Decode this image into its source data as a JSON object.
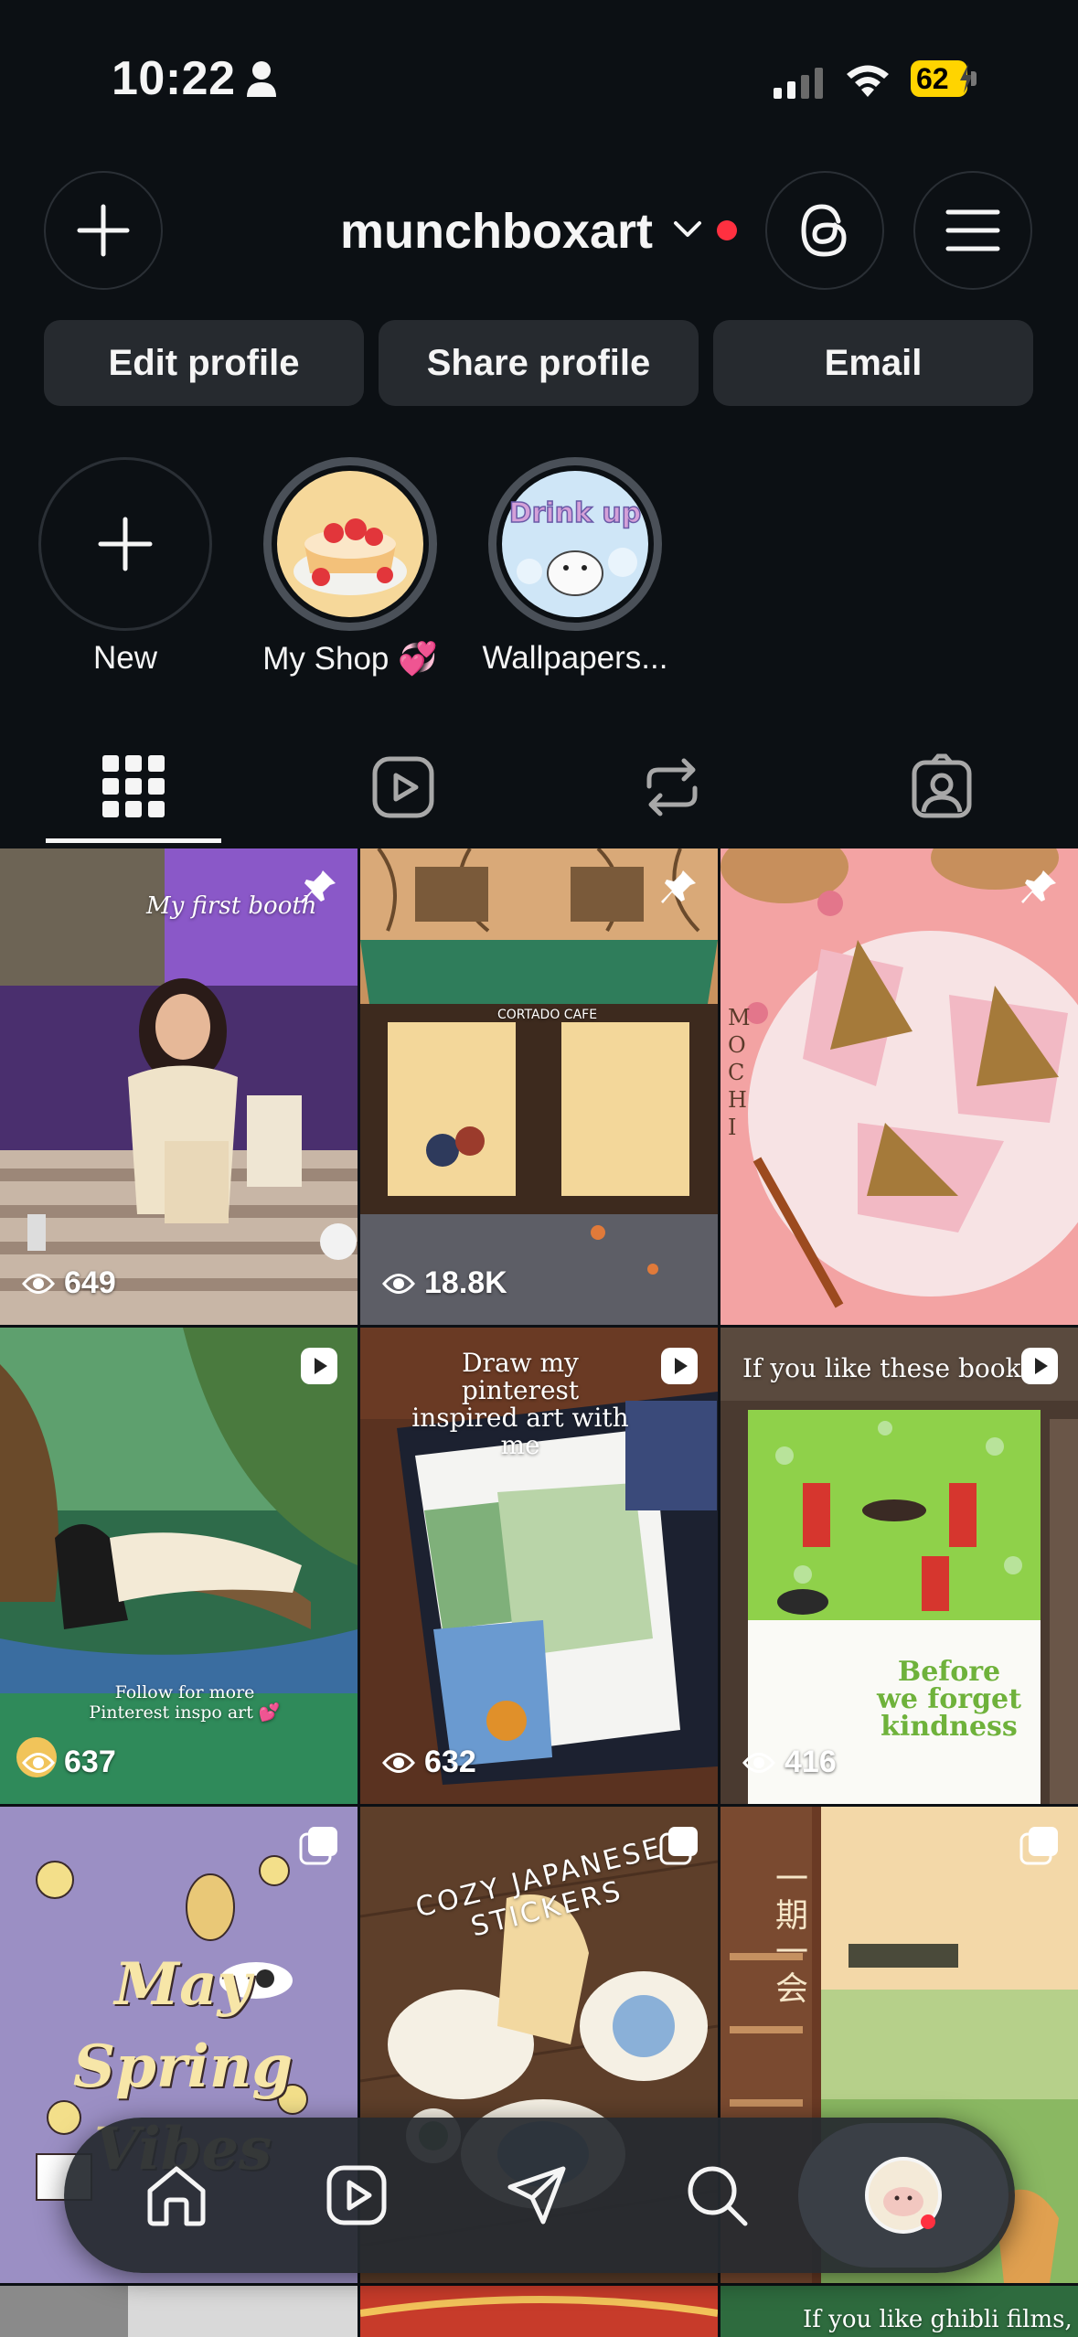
{
  "status_bar": {
    "time": "10:22",
    "battery": "62",
    "icons": [
      "person-icon",
      "signal-icon",
      "wifi-icon",
      "battery-charging-icon"
    ]
  },
  "header": {
    "username": "munchboxart",
    "icons": [
      "plus-icon",
      "chevron-down-icon",
      "threads-icon",
      "menu-icon"
    ],
    "notification_color": "#ff3040"
  },
  "buttons": {
    "edit_profile": "Edit profile",
    "share_profile": "Share profile",
    "email": "Email"
  },
  "highlights": [
    {
      "label": "New"
    },
    {
      "label": "My Shop 💞"
    },
    {
      "label": "Wallpapers..."
    }
  ],
  "tabs": [
    "grid-icon",
    "reels-icon",
    "reposts-icon",
    "tagged-icon"
  ],
  "posts": [
    {
      "caption": "My first booth",
      "views": "649",
      "badge": "pin-icon"
    },
    {
      "caption": "CORTADO CAFE",
      "views": "18.8K",
      "badge": "pin-icon"
    },
    {
      "caption": "MOCHI",
      "views": "",
      "badge": "pin-icon"
    },
    {
      "caption": "Follow for more Pinterest inspo art 💕",
      "views": "637",
      "badge": "reel-icon"
    },
    {
      "caption": "Draw my pinterest inspired art with me",
      "views": "632",
      "badge": "reel-icon"
    },
    {
      "caption": "If you like these books",
      "book": "Before we forget kindness",
      "views": "416",
      "badge": "reel-icon"
    },
    {
      "caption": "May Spring Vibes",
      "views": "",
      "badge": "carousel-icon"
    },
    {
      "caption": "COZY JAPANESE STICKERS",
      "views": "",
      "badge": "carousel-icon"
    },
    {
      "caption": "一期一会",
      "views": "",
      "badge": "carousel-icon"
    },
    {
      "caption": "If you like ghibli films,",
      "views": "",
      "badge": "reel-icon"
    }
  ],
  "bottom_nav": [
    "home-icon",
    "reels-icon",
    "send-icon",
    "search-icon",
    "profile-avatar"
  ],
  "colors": {
    "background": "#0c1014",
    "button": "#262a2f",
    "accent_red": "#ff3040",
    "battery": "#ffd400"
  }
}
